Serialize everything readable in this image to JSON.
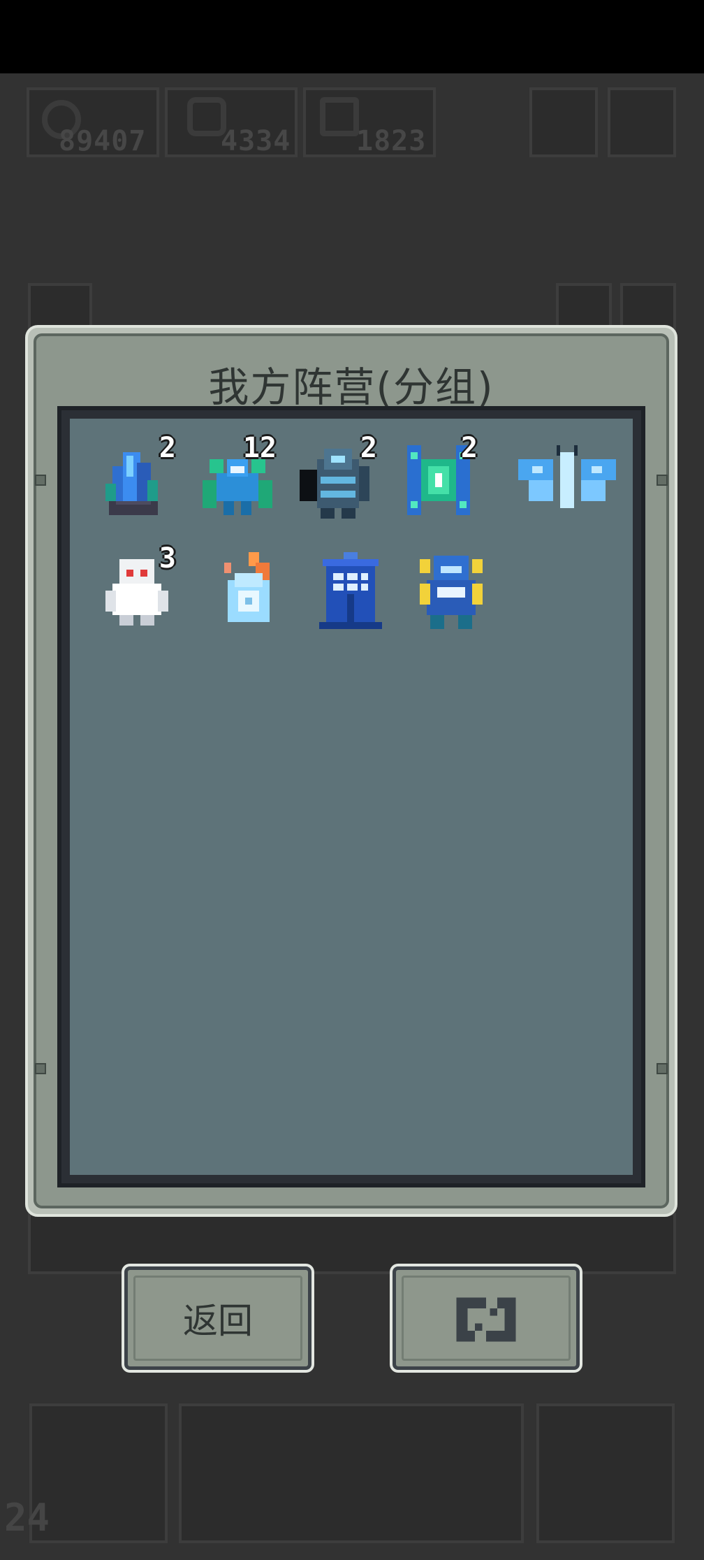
{
  "hud": {
    "coins": "89407",
    "gems": "4334",
    "souls": "1823",
    "level": "24"
  },
  "modal": {
    "title": "我方阵营(分组)",
    "units": [
      {
        "name": "crystal-golem",
        "count": "2",
        "icon": "blue-crystal-icon"
      },
      {
        "name": "mantis-beast",
        "count": "12",
        "icon": "green-mantis-icon"
      },
      {
        "name": "dark-knight",
        "count": "2",
        "icon": "armored-knight-icon"
      },
      {
        "name": "eye-totem",
        "count": "2",
        "icon": "green-eye-totem-icon"
      },
      {
        "name": "ice-moth",
        "count": "",
        "icon": "ice-moth-icon"
      },
      {
        "name": "yeti",
        "count": "3",
        "icon": "white-yeti-icon"
      },
      {
        "name": "frost-spirit",
        "count": "",
        "icon": "frost-flame-icon"
      },
      {
        "name": "blue-booth",
        "count": "",
        "icon": "blue-booth-icon"
      },
      {
        "name": "horned-warrior",
        "count": "",
        "icon": "horned-warrior-icon"
      }
    ]
  },
  "buttons": {
    "back_label": "返回",
    "refresh_icon": "refresh-icon"
  },
  "colors": {
    "modal_frame": "#b9c0b7",
    "panel_bg": "#5e7379",
    "button_bg": "#8e978c"
  }
}
